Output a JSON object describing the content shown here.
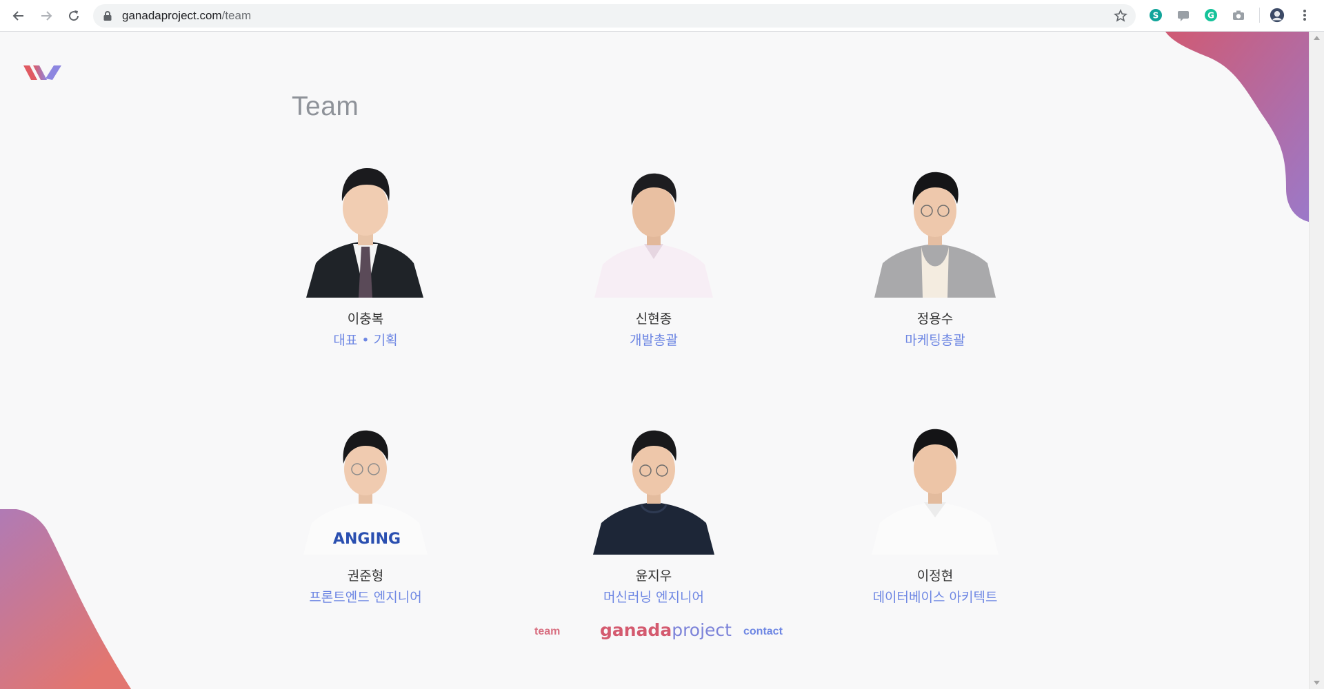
{
  "browser": {
    "url_domain": "ganadaproject.com",
    "url_path": "/team"
  },
  "page": {
    "title": "Team"
  },
  "members": [
    {
      "name": "이충복",
      "role": "대표 • 기획"
    },
    {
      "name": "신현종",
      "role": "개발총괄"
    },
    {
      "name": "정용수",
      "role": "마케팅총괄"
    },
    {
      "name": "권준형",
      "role": "프론트엔드 엔지니어"
    },
    {
      "name": "윤지우",
      "role": "머신러닝 엔지니어"
    },
    {
      "name": "이정현",
      "role": "데이터베이스 아키텍트"
    }
  ],
  "photo_print": "ANGING",
  "footer": {
    "team_link": "team",
    "brand_bold": "ganada",
    "brand_light": "project",
    "contact_link": "contact"
  },
  "colors": {
    "brand_pink": "#d45a6f",
    "brand_blue": "#6d86e3",
    "title_gray": "#8e9299",
    "background": "#f8f8f9"
  },
  "icons": [
    "back-icon",
    "forward-icon",
    "reload-icon",
    "lock-icon",
    "star-icon",
    "extension-icons",
    "profile-icon",
    "menu-icon"
  ]
}
